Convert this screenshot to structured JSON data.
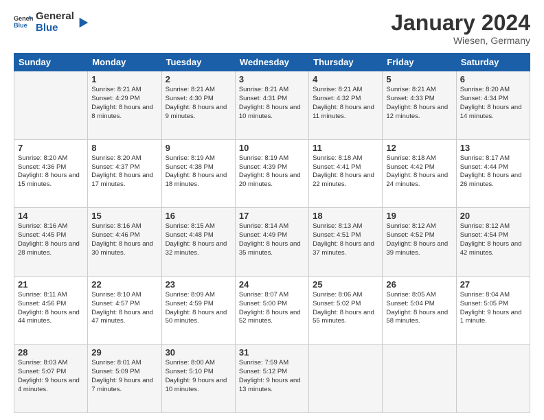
{
  "logo": {
    "text_general": "General",
    "text_blue": "Blue"
  },
  "header": {
    "month": "January 2024",
    "location": "Wiesen, Germany"
  },
  "days_of_week": [
    "Sunday",
    "Monday",
    "Tuesday",
    "Wednesday",
    "Thursday",
    "Friday",
    "Saturday"
  ],
  "weeks": [
    [
      {
        "day": "",
        "sunrise": "",
        "sunset": "",
        "daylight": ""
      },
      {
        "day": "1",
        "sunrise": "Sunrise: 8:21 AM",
        "sunset": "Sunset: 4:29 PM",
        "daylight": "Daylight: 8 hours and 8 minutes."
      },
      {
        "day": "2",
        "sunrise": "Sunrise: 8:21 AM",
        "sunset": "Sunset: 4:30 PM",
        "daylight": "Daylight: 8 hours and 9 minutes."
      },
      {
        "day": "3",
        "sunrise": "Sunrise: 8:21 AM",
        "sunset": "Sunset: 4:31 PM",
        "daylight": "Daylight: 8 hours and 10 minutes."
      },
      {
        "day": "4",
        "sunrise": "Sunrise: 8:21 AM",
        "sunset": "Sunset: 4:32 PM",
        "daylight": "Daylight: 8 hours and 11 minutes."
      },
      {
        "day": "5",
        "sunrise": "Sunrise: 8:21 AM",
        "sunset": "Sunset: 4:33 PM",
        "daylight": "Daylight: 8 hours and 12 minutes."
      },
      {
        "day": "6",
        "sunrise": "Sunrise: 8:20 AM",
        "sunset": "Sunset: 4:34 PM",
        "daylight": "Daylight: 8 hours and 14 minutes."
      }
    ],
    [
      {
        "day": "7",
        "sunrise": "Sunrise: 8:20 AM",
        "sunset": "Sunset: 4:36 PM",
        "daylight": "Daylight: 8 hours and 15 minutes."
      },
      {
        "day": "8",
        "sunrise": "Sunrise: 8:20 AM",
        "sunset": "Sunset: 4:37 PM",
        "daylight": "Daylight: 8 hours and 17 minutes."
      },
      {
        "day": "9",
        "sunrise": "Sunrise: 8:19 AM",
        "sunset": "Sunset: 4:38 PM",
        "daylight": "Daylight: 8 hours and 18 minutes."
      },
      {
        "day": "10",
        "sunrise": "Sunrise: 8:19 AM",
        "sunset": "Sunset: 4:39 PM",
        "daylight": "Daylight: 8 hours and 20 minutes."
      },
      {
        "day": "11",
        "sunrise": "Sunrise: 8:18 AM",
        "sunset": "Sunset: 4:41 PM",
        "daylight": "Daylight: 8 hours and 22 minutes."
      },
      {
        "day": "12",
        "sunrise": "Sunrise: 8:18 AM",
        "sunset": "Sunset: 4:42 PM",
        "daylight": "Daylight: 8 hours and 24 minutes."
      },
      {
        "day": "13",
        "sunrise": "Sunrise: 8:17 AM",
        "sunset": "Sunset: 4:44 PM",
        "daylight": "Daylight: 8 hours and 26 minutes."
      }
    ],
    [
      {
        "day": "14",
        "sunrise": "Sunrise: 8:16 AM",
        "sunset": "Sunset: 4:45 PM",
        "daylight": "Daylight: 8 hours and 28 minutes."
      },
      {
        "day": "15",
        "sunrise": "Sunrise: 8:16 AM",
        "sunset": "Sunset: 4:46 PM",
        "daylight": "Daylight: 8 hours and 30 minutes."
      },
      {
        "day": "16",
        "sunrise": "Sunrise: 8:15 AM",
        "sunset": "Sunset: 4:48 PM",
        "daylight": "Daylight: 8 hours and 32 minutes."
      },
      {
        "day": "17",
        "sunrise": "Sunrise: 8:14 AM",
        "sunset": "Sunset: 4:49 PM",
        "daylight": "Daylight: 8 hours and 35 minutes."
      },
      {
        "day": "18",
        "sunrise": "Sunrise: 8:13 AM",
        "sunset": "Sunset: 4:51 PM",
        "daylight": "Daylight: 8 hours and 37 minutes."
      },
      {
        "day": "19",
        "sunrise": "Sunrise: 8:12 AM",
        "sunset": "Sunset: 4:52 PM",
        "daylight": "Daylight: 8 hours and 39 minutes."
      },
      {
        "day": "20",
        "sunrise": "Sunrise: 8:12 AM",
        "sunset": "Sunset: 4:54 PM",
        "daylight": "Daylight: 8 hours and 42 minutes."
      }
    ],
    [
      {
        "day": "21",
        "sunrise": "Sunrise: 8:11 AM",
        "sunset": "Sunset: 4:56 PM",
        "daylight": "Daylight: 8 hours and 44 minutes."
      },
      {
        "day": "22",
        "sunrise": "Sunrise: 8:10 AM",
        "sunset": "Sunset: 4:57 PM",
        "daylight": "Daylight: 8 hours and 47 minutes."
      },
      {
        "day": "23",
        "sunrise": "Sunrise: 8:09 AM",
        "sunset": "Sunset: 4:59 PM",
        "daylight": "Daylight: 8 hours and 50 minutes."
      },
      {
        "day": "24",
        "sunrise": "Sunrise: 8:07 AM",
        "sunset": "Sunset: 5:00 PM",
        "daylight": "Daylight: 8 hours and 52 minutes."
      },
      {
        "day": "25",
        "sunrise": "Sunrise: 8:06 AM",
        "sunset": "Sunset: 5:02 PM",
        "daylight": "Daylight: 8 hours and 55 minutes."
      },
      {
        "day": "26",
        "sunrise": "Sunrise: 8:05 AM",
        "sunset": "Sunset: 5:04 PM",
        "daylight": "Daylight: 8 hours and 58 minutes."
      },
      {
        "day": "27",
        "sunrise": "Sunrise: 8:04 AM",
        "sunset": "Sunset: 5:05 PM",
        "daylight": "Daylight: 9 hours and 1 minute."
      }
    ],
    [
      {
        "day": "28",
        "sunrise": "Sunrise: 8:03 AM",
        "sunset": "Sunset: 5:07 PM",
        "daylight": "Daylight: 9 hours and 4 minutes."
      },
      {
        "day": "29",
        "sunrise": "Sunrise: 8:01 AM",
        "sunset": "Sunset: 5:09 PM",
        "daylight": "Daylight: 9 hours and 7 minutes."
      },
      {
        "day": "30",
        "sunrise": "Sunrise: 8:00 AM",
        "sunset": "Sunset: 5:10 PM",
        "daylight": "Daylight: 9 hours and 10 minutes."
      },
      {
        "day": "31",
        "sunrise": "Sunrise: 7:59 AM",
        "sunset": "Sunset: 5:12 PM",
        "daylight": "Daylight: 9 hours and 13 minutes."
      },
      {
        "day": "",
        "sunrise": "",
        "sunset": "",
        "daylight": ""
      },
      {
        "day": "",
        "sunrise": "",
        "sunset": "",
        "daylight": ""
      },
      {
        "day": "",
        "sunrise": "",
        "sunset": "",
        "daylight": ""
      }
    ]
  ]
}
